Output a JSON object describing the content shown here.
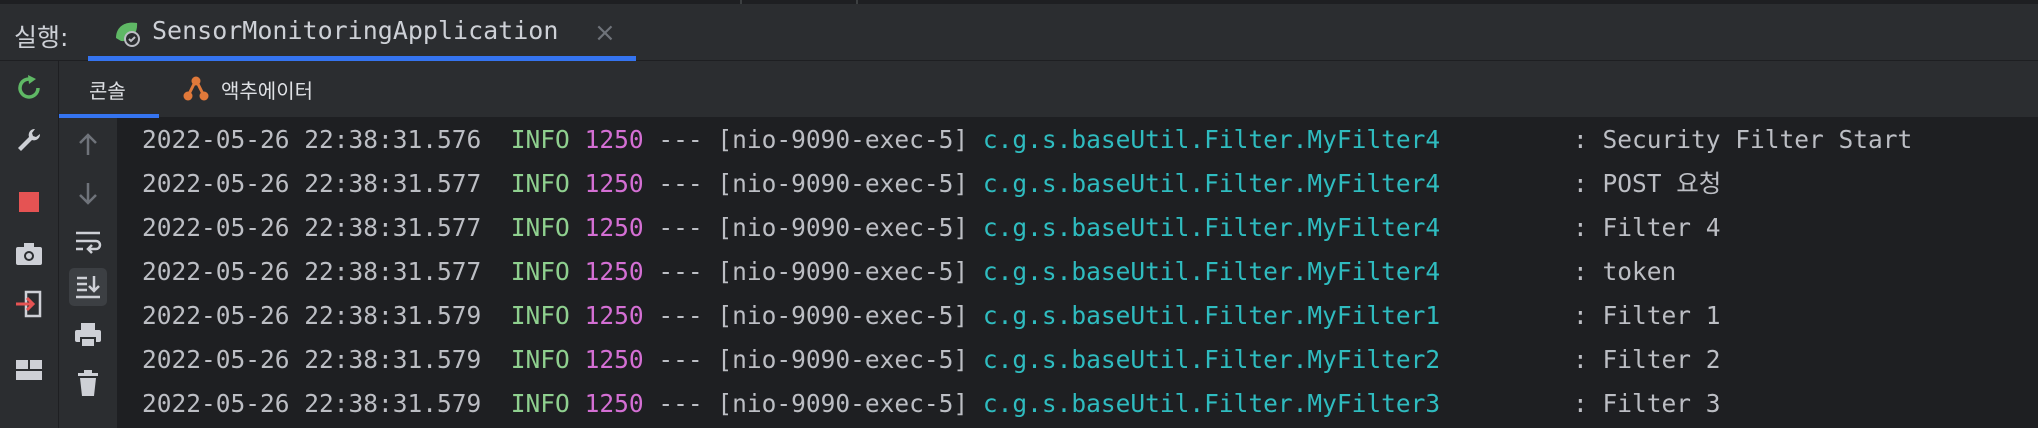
{
  "run_bar": {
    "label": "실행:",
    "tab_title": "SensorMonitoringApplication",
    "close_glyph": "×"
  },
  "sub_tabs": [
    {
      "label": "콘솔",
      "active": true
    },
    {
      "label": "액추에이터",
      "active": false,
      "icon": "actuator-icon"
    }
  ],
  "left_toolbar": {
    "icons": [
      "rerun-icon",
      "wrench-icon",
      "stop-icon",
      "camera-icon",
      "login-icon",
      "layout-icon"
    ]
  },
  "gutter": {
    "icons": [
      "arrow-up-icon",
      "arrow-down-icon",
      "soft-wrap-icon",
      "scroll-to-end-icon",
      "print-icon",
      "trash-icon"
    ]
  },
  "colors": {
    "accent": "#3574f0",
    "info": "#8fd08f",
    "pid": "#d46fd4",
    "class": "#2fbcc0",
    "stop": "#e55353",
    "rerun": "#5fb865"
  },
  "log_lines": [
    {
      "timestamp": "2022-05-26 22:38:31.576",
      "level": "INFO",
      "pid": "1250",
      "sep": "---",
      "thread": "[nio-9090-exec-5]",
      "logger": "c.g.s.baseUtil.Filter.MyFilter4",
      "message": ": Security Filter Start"
    },
    {
      "timestamp": "2022-05-26 22:38:31.577",
      "level": "INFO",
      "pid": "1250",
      "sep": "---",
      "thread": "[nio-9090-exec-5]",
      "logger": "c.g.s.baseUtil.Filter.MyFilter4",
      "message": ": POST 요청"
    },
    {
      "timestamp": "2022-05-26 22:38:31.577",
      "level": "INFO",
      "pid": "1250",
      "sep": "---",
      "thread": "[nio-9090-exec-5]",
      "logger": "c.g.s.baseUtil.Filter.MyFilter4",
      "message": ": Filter 4"
    },
    {
      "timestamp": "2022-05-26 22:38:31.577",
      "level": "INFO",
      "pid": "1250",
      "sep": "---",
      "thread": "[nio-9090-exec-5]",
      "logger": "c.g.s.baseUtil.Filter.MyFilter4",
      "message": ": token"
    },
    {
      "timestamp": "2022-05-26 22:38:31.579",
      "level": "INFO",
      "pid": "1250",
      "sep": "---",
      "thread": "[nio-9090-exec-5]",
      "logger": "c.g.s.baseUtil.Filter.MyFilter1",
      "message": ": Filter 1"
    },
    {
      "timestamp": "2022-05-26 22:38:31.579",
      "level": "INFO",
      "pid": "1250",
      "sep": "---",
      "thread": "[nio-9090-exec-5]",
      "logger": "c.g.s.baseUtil.Filter.MyFilter2",
      "message": ": Filter 2"
    },
    {
      "timestamp": "2022-05-26 22:38:31.579",
      "level": "INFO",
      "pid": "1250",
      "sep": "---",
      "thread": "[nio-9090-exec-5]",
      "logger": "c.g.s.baseUtil.Filter.MyFilter3",
      "message": ": Filter 3"
    }
  ]
}
